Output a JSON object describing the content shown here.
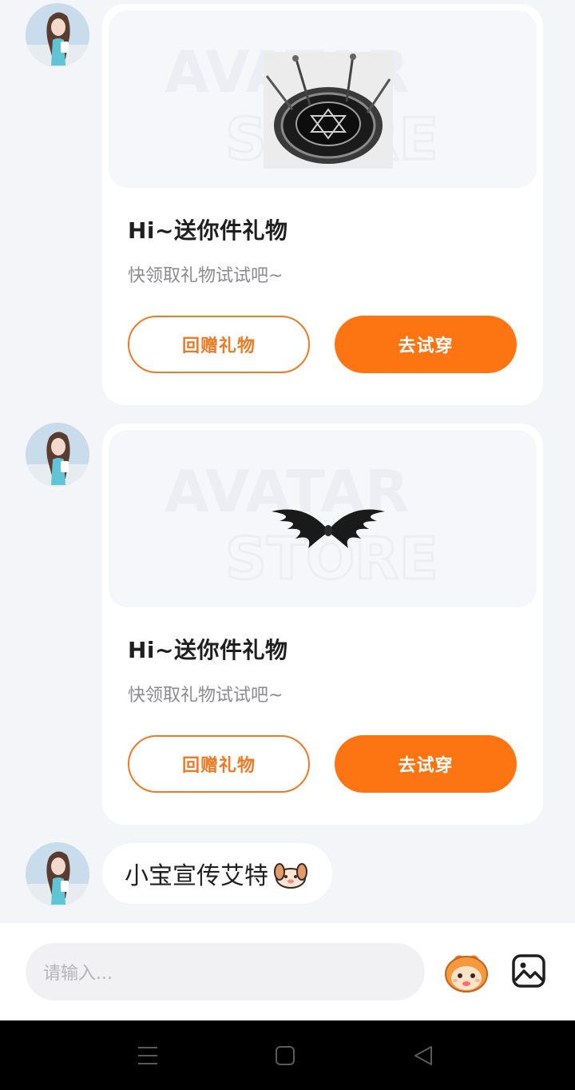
{
  "messages": [
    {
      "type": "gift",
      "title": "Hi~送你件礼物",
      "subtitle": "快领取礼物试试吧~",
      "gift_icon": "magic-circle-icon",
      "primary_button": "去试穿",
      "secondary_button": "回赠礼物",
      "watermark_line1": "AVATAR",
      "watermark_line2": "STORE"
    },
    {
      "type": "gift",
      "title": "Hi~送你件礼物",
      "subtitle": "快领取礼物试试吧~",
      "gift_icon": "black-wings-icon",
      "primary_button": "去试穿",
      "secondary_button": "回赠礼物",
      "watermark_line1": "AVATAR",
      "watermark_line2": "STORE"
    },
    {
      "type": "text",
      "text": "小宝宣传艾特",
      "emoji": "puppy-emoji-icon"
    }
  ],
  "input": {
    "placeholder": "请输入..."
  },
  "colors": {
    "accent": "#fd7413",
    "accent_outline": "#f07a24",
    "background": "#f3f5f9",
    "card": "#ffffff"
  }
}
